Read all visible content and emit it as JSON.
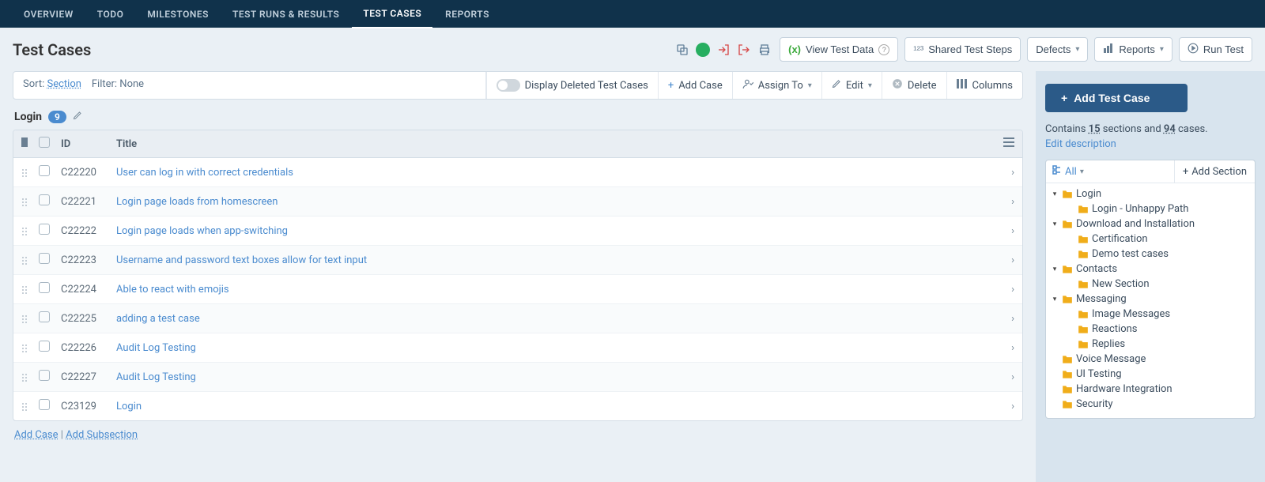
{
  "nav": {
    "items": [
      "OVERVIEW",
      "TODO",
      "MILESTONES",
      "TEST RUNS & RESULTS",
      "TEST CASES",
      "REPORTS"
    ],
    "active_index": 4
  },
  "page_title": "Test Cases",
  "header_buttons": {
    "view_test_data": "View Test Data",
    "shared_steps": "Shared Test Steps",
    "defects": "Defects",
    "reports": "Reports",
    "run_test": "Run Test"
  },
  "toolbar": {
    "sort_label": "Sort:",
    "sort_value": "Section",
    "filter_label": "Filter:",
    "filter_value": "None",
    "display_deleted": "Display Deleted Test Cases",
    "add_case": "Add Case",
    "assign_to": "Assign To",
    "edit": "Edit",
    "delete": "Delete",
    "columns": "Columns"
  },
  "section": {
    "name": "Login",
    "count": "9"
  },
  "columns": {
    "id": "ID",
    "title": "Title"
  },
  "rows": [
    {
      "id": "C22220",
      "title": "User can log in with correct credentials"
    },
    {
      "id": "C22221",
      "title": "Login page loads from homescreen"
    },
    {
      "id": "C22222",
      "title": "Login page loads when app-switching"
    },
    {
      "id": "C22223",
      "title": "Username and password text boxes allow for text input"
    },
    {
      "id": "C22224",
      "title": "Able to react with emojis"
    },
    {
      "id": "C22225",
      "title": "adding a test case"
    },
    {
      "id": "C22226",
      "title": "Audit Log Testing"
    },
    {
      "id": "C22227",
      "title": "Audit Log Testing"
    },
    {
      "id": "C23129",
      "title": "Login"
    }
  ],
  "footer": {
    "add_case": "Add Case",
    "add_subsection": "Add Subsection",
    "sep": " | "
  },
  "sidebar": {
    "add_test_case": "Add Test Case",
    "contains_prefix": "Contains ",
    "sections_count": "15",
    "sections_label": " sections and ",
    "cases_count": "94",
    "cases_label": " cases.",
    "edit_description": "Edit description",
    "all_label": "All",
    "add_section": "Add Section",
    "tree": [
      {
        "d": 0,
        "exp": true,
        "name": "Login"
      },
      {
        "d": 1,
        "exp": null,
        "name": "Login - Unhappy Path"
      },
      {
        "d": 0,
        "exp": true,
        "name": "Download and Installation"
      },
      {
        "d": 1,
        "exp": null,
        "name": "Certification"
      },
      {
        "d": 1,
        "exp": null,
        "name": "Demo test cases"
      },
      {
        "d": 0,
        "exp": true,
        "name": "Contacts"
      },
      {
        "d": 1,
        "exp": null,
        "name": "New Section"
      },
      {
        "d": 0,
        "exp": true,
        "name": "Messaging"
      },
      {
        "d": 1,
        "exp": null,
        "name": "Image Messages"
      },
      {
        "d": 1,
        "exp": null,
        "name": "Reactions"
      },
      {
        "d": 1,
        "exp": null,
        "name": "Replies"
      },
      {
        "d": 0,
        "exp": null,
        "name": "Voice Message"
      },
      {
        "d": 0,
        "exp": null,
        "name": "UI Testing"
      },
      {
        "d": 0,
        "exp": null,
        "name": "Hardware Integration"
      },
      {
        "d": 0,
        "exp": null,
        "name": "Security"
      }
    ]
  }
}
